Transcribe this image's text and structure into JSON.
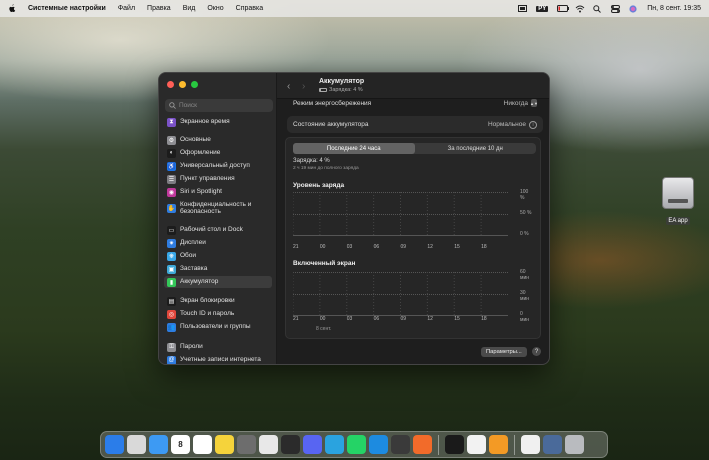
{
  "menubar": {
    "apple_icon": "apple-logo-icon",
    "app_name": "Системные настройки",
    "items": [
      "Файл",
      "Правка",
      "Вид",
      "Окно",
      "Справка"
    ],
    "kbd_layout": "PY",
    "datetime": "Пн, 8 сент.  19:35"
  },
  "desktop": {
    "drive_label": "EA app"
  },
  "sidebar": {
    "search_placeholder": "Поиск",
    "items": [
      {
        "label": "Экранное время",
        "color": "#7b52c8"
      },
      {
        "label": "Основные",
        "color": "#8e8e93"
      },
      {
        "label": "Оформление",
        "color": "#1c1c1c"
      },
      {
        "label": "Универсальный доступ",
        "color": "#1a73e8"
      },
      {
        "label": "Пункт управления",
        "color": "#7d7d82"
      },
      {
        "label": "Siri и Spotlight",
        "color": "#c0389b"
      },
      {
        "label": "Конфиденциальность и безопасность",
        "color": "#2f7ce0"
      },
      {
        "label": "Рабочий стол и Dock",
        "color": "#1c1c1c"
      },
      {
        "label": "Дисплеи",
        "color": "#2f7ce0"
      },
      {
        "label": "Обои",
        "color": "#38a7e8"
      },
      {
        "label": "Заставка",
        "color": "#3fa9d8"
      },
      {
        "label": "Аккумулятор",
        "color": "#34c759"
      },
      {
        "label": "Экран блокировки",
        "color": "#1c1c1c"
      },
      {
        "label": "Touch ID и пароль",
        "color": "#e0463b"
      },
      {
        "label": "Пользователи и группы",
        "color": "#2f7ce0"
      },
      {
        "label": "Пароли",
        "color": "#8e8e93"
      },
      {
        "label": "Учетные записи интернета",
        "color": "#2f7ce0"
      }
    ]
  },
  "header": {
    "title": "Аккумулятор",
    "subtitle": "Зарядка: 4 %"
  },
  "settings": {
    "energy_mode_label": "Режим энергосбережения",
    "energy_mode_value": "Никогда",
    "battery_health_label": "Состояние аккумулятора",
    "battery_health_value": "Нормальное"
  },
  "usage": {
    "tabs": [
      "Последние 24 часа",
      "За последние 10 дн"
    ],
    "active_tab": 0,
    "charge_text": "Зарядка: 4 %",
    "charge_eta": "2 ч 19 мин до полного заряда",
    "charge_title": "Уровень заряда",
    "screen_title": "Включенный экран",
    "date_label": "8 сент."
  },
  "chart_data": [
    {
      "type": "bar",
      "title": "Уровень заряда",
      "categories": [
        "21",
        "00",
        "03",
        "06",
        "09",
        "12",
        "15",
        "18"
      ],
      "y_ticks": [
        "100 %",
        "50 %",
        "0 %"
      ],
      "ylim": [
        0,
        100
      ],
      "values": []
    },
    {
      "type": "bar",
      "title": "Включенный экран",
      "categories": [
        "21",
        "00",
        "03",
        "06",
        "09",
        "12",
        "15",
        "18"
      ],
      "y_ticks": [
        "60 мин",
        "30 мин",
        "0 мин"
      ],
      "ylim": [
        0,
        60
      ],
      "values": []
    }
  ],
  "footer": {
    "params_button": "Параметры...",
    "help_button": "?"
  },
  "dock": {
    "calendar_day": "8",
    "apps": [
      {
        "name": "finder-icon",
        "color": "#2b7de9"
      },
      {
        "name": "launchpad-icon",
        "color": "#d9d9d9"
      },
      {
        "name": "mail-icon",
        "color": "#3d9af3"
      },
      {
        "name": "calendar-icon",
        "color": "#ffffff"
      },
      {
        "name": "reminders-icon",
        "color": "#ffffff"
      },
      {
        "name": "notes-icon",
        "color": "#f5d33b"
      },
      {
        "name": "system-settings-icon",
        "color": "#6d6d6d"
      },
      {
        "name": "chrome-icon",
        "color": "#e8e8e8"
      },
      {
        "name": "terminal-icon",
        "color": "#2b2b2b"
      },
      {
        "name": "discord-icon",
        "color": "#5865f2"
      },
      {
        "name": "telegram-icon",
        "color": "#2aa3df"
      },
      {
        "name": "whatsapp-icon",
        "color": "#25d366"
      },
      {
        "name": "docker-icon",
        "color": "#1d8be0"
      },
      {
        "name": "calculator-icon",
        "color": "#3a3a3a"
      },
      {
        "name": "pencil-app-icon",
        "color": "#f26b2a"
      },
      {
        "name": "chatgpt-icon",
        "color": "#1a1a1a"
      },
      {
        "name": "textedit-icon",
        "color": "#f2f2f2"
      },
      {
        "name": "books-icon",
        "color": "#f39a25"
      },
      {
        "name": "document-icon",
        "color": "#f0f0f0"
      },
      {
        "name": "downloads-stack-icon",
        "color": "#4a6a9a"
      },
      {
        "name": "trash-icon",
        "color": "#b9bbbf"
      }
    ]
  }
}
